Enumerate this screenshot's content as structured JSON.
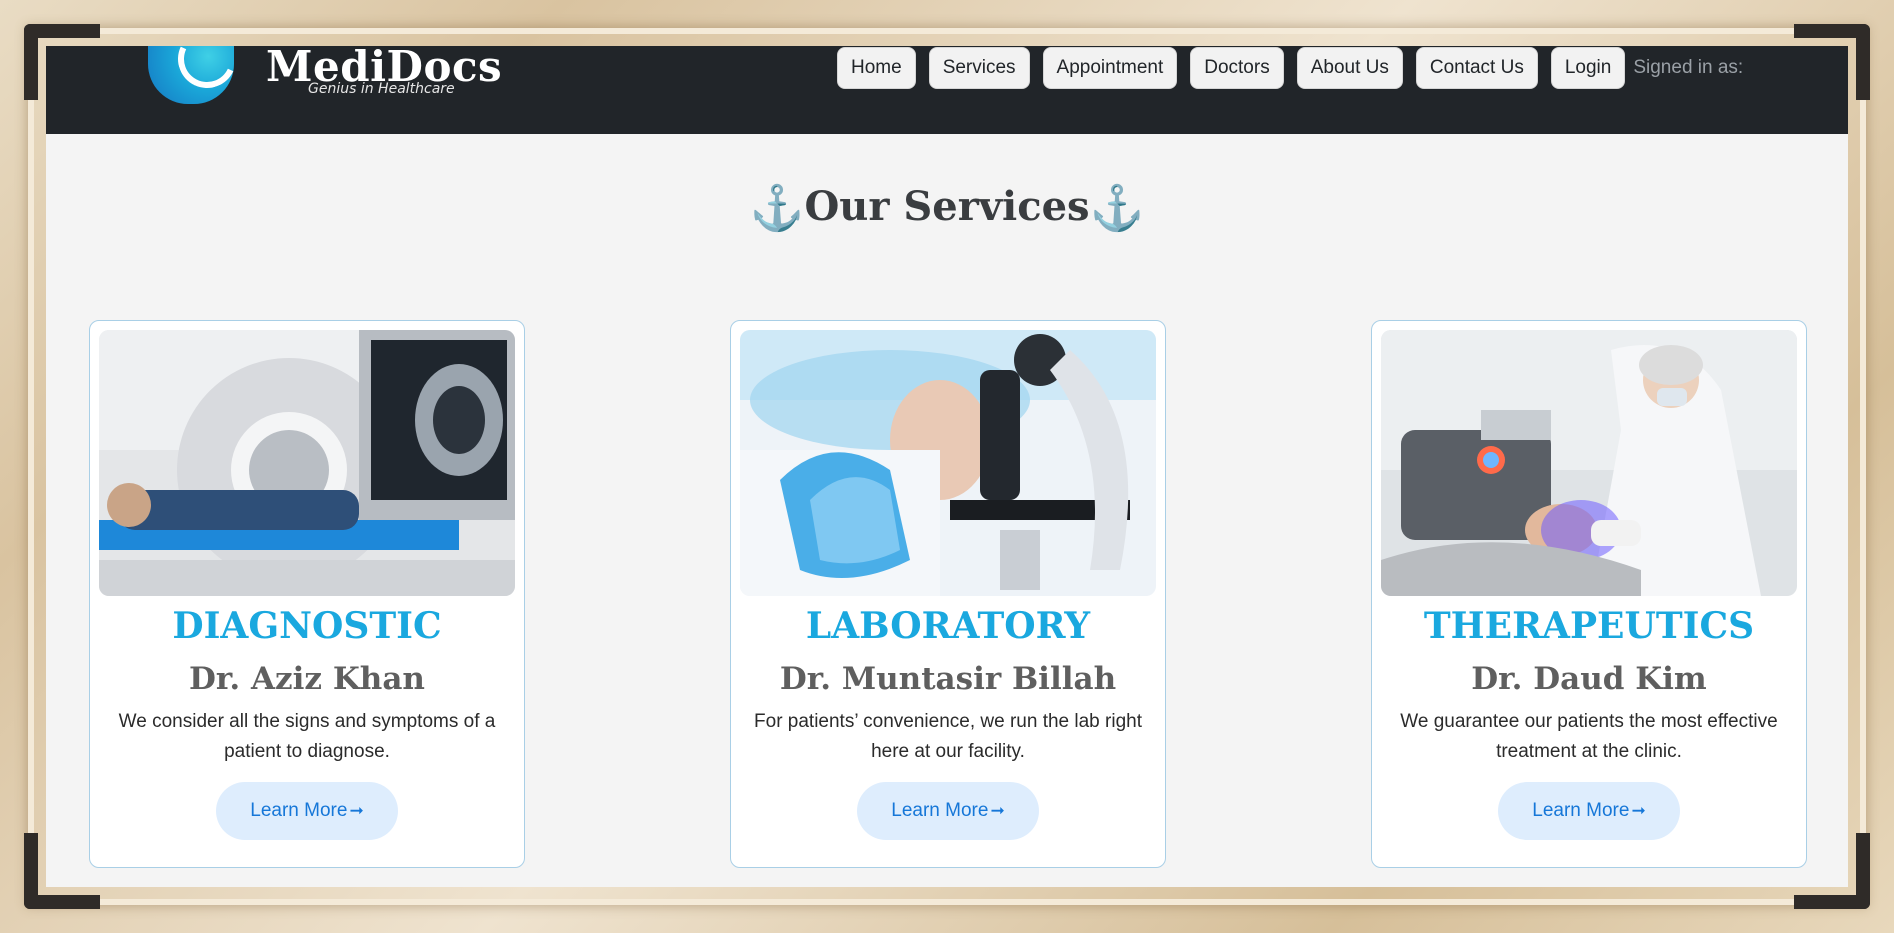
{
  "brand": {
    "name": "MediDocs",
    "tagline": "Genius in Healthcare"
  },
  "nav": {
    "items": [
      {
        "label": "Home"
      },
      {
        "label": "Services"
      },
      {
        "label": "Appointment"
      },
      {
        "label": "Doctors"
      },
      {
        "label": "About Us"
      },
      {
        "label": "Contact Us"
      },
      {
        "label": "Login"
      }
    ],
    "signed_in_text": "Signed in as:"
  },
  "section": {
    "title": "Our Services",
    "anchor_icon": "⚓"
  },
  "cards": [
    {
      "title": "DIAGNOSTIC",
      "doctor": "Dr. Aziz Khan",
      "description": "We consider all the signs and symptoms of a patient to diagnose.",
      "button_label": "Learn More",
      "button_icon": "➞",
      "image": "ct-scan-patient-photo"
    },
    {
      "title": "LABORATORY",
      "doctor": "Dr. Muntasir Billah",
      "description": "For patients’ convenience, we run the lab right here at our facility.",
      "button_label": "Learn More",
      "button_icon": "➞",
      "image": "lab-microscope-photo"
    },
    {
      "title": "THERAPEUTICS",
      "doctor": "Dr. Daud Kim",
      "description": "We guarantee our patients the most effective treatment at the clinic.",
      "button_label": "Learn More",
      "button_icon": "➞",
      "image": "facial-therapy-photo"
    }
  ],
  "colors": {
    "navbar": "#212529",
    "accent_title": "#1aa8df",
    "button_bg": "#deedfd",
    "button_text": "#1677d8"
  }
}
